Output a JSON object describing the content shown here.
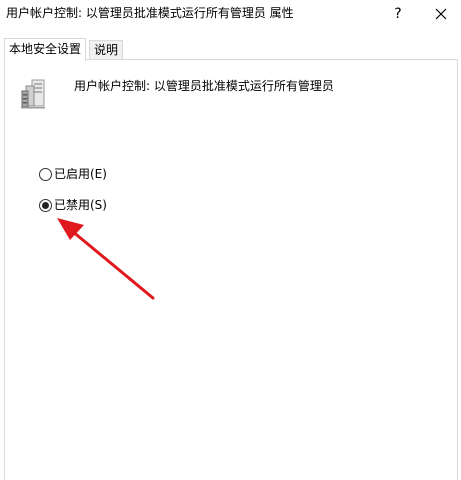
{
  "window": {
    "title": "用户帐户控制: 以管理员批准模式运行所有管理员 属性",
    "help_label": "?",
    "close_icon": "close-icon"
  },
  "tabs": [
    {
      "label": "本地安全设置",
      "active": true
    },
    {
      "label": "说明",
      "active": false
    }
  ],
  "policy": {
    "icon": "server-policy-icon",
    "name": "用户帐户控制: 以管理员批准模式运行所有管理员"
  },
  "options": {
    "enabled_label": "已启用(E)",
    "disabled_label": "已禁用(S)",
    "selected": "disabled"
  },
  "annotation": {
    "arrow_color": "#e0191f"
  }
}
